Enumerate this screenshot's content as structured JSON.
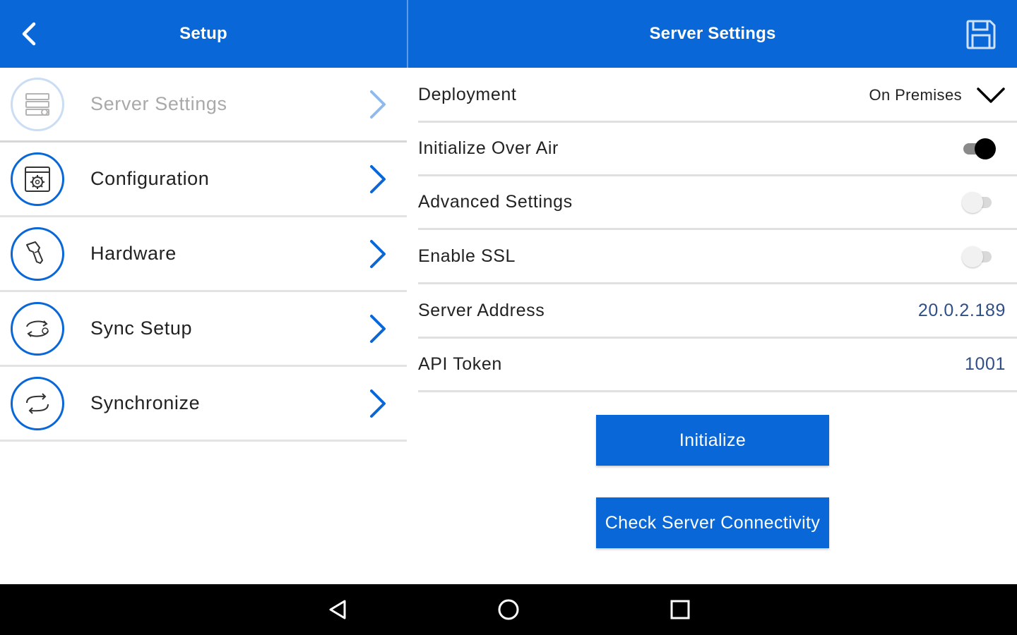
{
  "colors": {
    "accent": "#0a67d8",
    "navbar": "#000000",
    "value_text": "#2f4f86"
  },
  "left_panel": {
    "header": {
      "title": "Setup",
      "back_icon": "chevron-left-icon"
    },
    "items": [
      {
        "label": "Server Settings",
        "icon": "server-settings-icon",
        "disabled": true
      },
      {
        "label": "Configuration",
        "icon": "configuration-gear-icon",
        "disabled": false
      },
      {
        "label": "Hardware",
        "icon": "barcode-scanner-icon",
        "disabled": false
      },
      {
        "label": "Sync Setup",
        "icon": "sync-setup-icon",
        "disabled": false
      },
      {
        "label": "Synchronize",
        "icon": "sync-icon",
        "disabled": false
      }
    ]
  },
  "right_panel": {
    "header": {
      "title": "Server Settings",
      "save_icon": "save-icon"
    },
    "settings": {
      "deployment": {
        "label": "Deployment",
        "value": "On Premises"
      },
      "initialize_over_air": {
        "label": "Initialize Over Air",
        "enabled": true
      },
      "advanced_settings": {
        "label": "Advanced Settings",
        "enabled": false
      },
      "enable_ssl": {
        "label": "Enable SSL",
        "enabled": false
      },
      "server_address": {
        "label": "Server Address",
        "value": "20.0.2.189"
      },
      "api_token": {
        "label": "API Token",
        "value": "1001"
      }
    },
    "buttons": {
      "initialize": "Initialize",
      "check_connectivity": "Check Server Connectivity"
    }
  },
  "navbar": {
    "icons": [
      "nav-back-icon",
      "nav-home-icon",
      "nav-recents-icon"
    ]
  }
}
